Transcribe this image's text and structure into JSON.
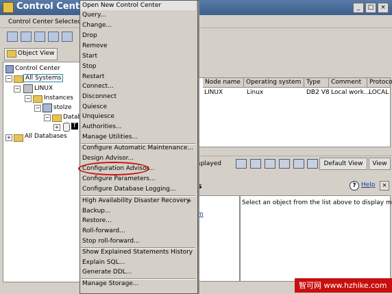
{
  "window": {
    "title": "Control Center",
    "buttons": [
      "_",
      "□",
      "×"
    ]
  },
  "menubar": {
    "items": [
      "Control Center",
      "Selected"
    ]
  },
  "object_view_tab": {
    "label": "Object View"
  },
  "tree": {
    "control_center": "Control Center",
    "all_systems": "All Systems",
    "linux": "LINUX",
    "instances": "Instances",
    "stolze": "stolze",
    "databases": "Datab",
    "selected_db": "T",
    "all_databases": "All Databases"
  },
  "grid": {
    "columns": [
      "Node name",
      "Operating system",
      "Type",
      "Comment",
      "Protoco"
    ],
    "row": [
      "LINUX",
      "Linux",
      "DB2 V8",
      "Local work...",
      "LOCAL"
    ]
  },
  "bottom_toolbar": {
    "displayed_label": "splayed",
    "view_select": "Default View",
    "view_button": "View"
  },
  "details": {
    "header": "s",
    "help_label": "Help",
    "message": "Select an object from the list above to display more",
    "link_fragment": "m"
  },
  "popup_menu": {
    "items": [
      "Open New Control Center",
      "Query...",
      "Change...",
      "Drop",
      "Remove",
      "Start",
      "Stop",
      "Restart",
      "Connect...",
      "Disconnect",
      "Quiesce",
      "Unquiesce",
      "Authorities...",
      "Manage Utilities...",
      "Configure Automatic Maintenance...",
      "Design Advisor...",
      "Configuration Advisor...",
      "Configure Parameters...",
      "Configure Database Logging...",
      "High Availability Disaster Recovery",
      "Backup...",
      "Restore...",
      "Roll-forward...",
      "Stop roll-forward...",
      "Show Explained Statements History",
      "Explain SQL...",
      "Generate DDL...",
      "Manage Storage..."
    ],
    "submenu_arrow": "▶"
  },
  "watermark": {
    "text": "智可网 www.hzhike.com"
  },
  "colors": {
    "highlight_circle": "#cc1010",
    "watermark_bg": "#c80f0f"
  }
}
